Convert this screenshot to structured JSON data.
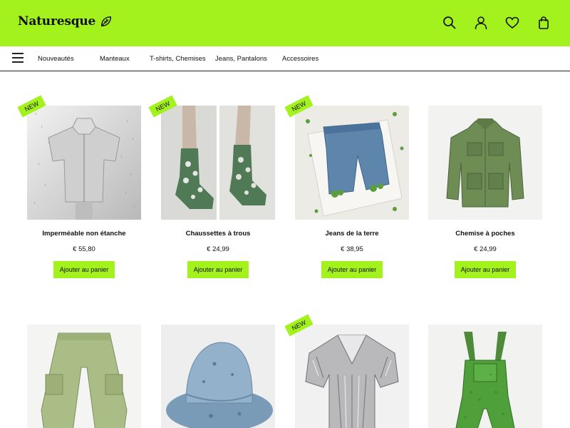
{
  "header": {
    "brand": "Naturesque",
    "icons": [
      "search-icon",
      "user-icon",
      "heart-icon",
      "bag-icon"
    ],
    "accent": "#a4f21d"
  },
  "nav": {
    "items": [
      "Nouveautés",
      "Manteaux",
      "T-shirts, Chemises",
      "Jeans, Pantalons",
      "Accessoires"
    ]
  },
  "badge_label": "NEW",
  "products": [
    {
      "name": "Imperméable non étanche",
      "price": "€ 55,80",
      "button": "Ajouter au panier",
      "badge": true
    },
    {
      "name": "Chaussettes à trous",
      "price": "€ 24,99",
      "button": "Ajouter au panier",
      "badge": true
    },
    {
      "name": "Jeans de la terre",
      "price": "€ 38,95",
      "button": "Ajouter au panier",
      "badge": true
    },
    {
      "name": "Chemise à poches",
      "price": "€ 24,99",
      "button": "Ajouter au panier",
      "badge": false
    },
    {
      "badge": false
    },
    {
      "badge": false
    },
    {
      "badge": true
    },
    {
      "badge": false
    }
  ]
}
